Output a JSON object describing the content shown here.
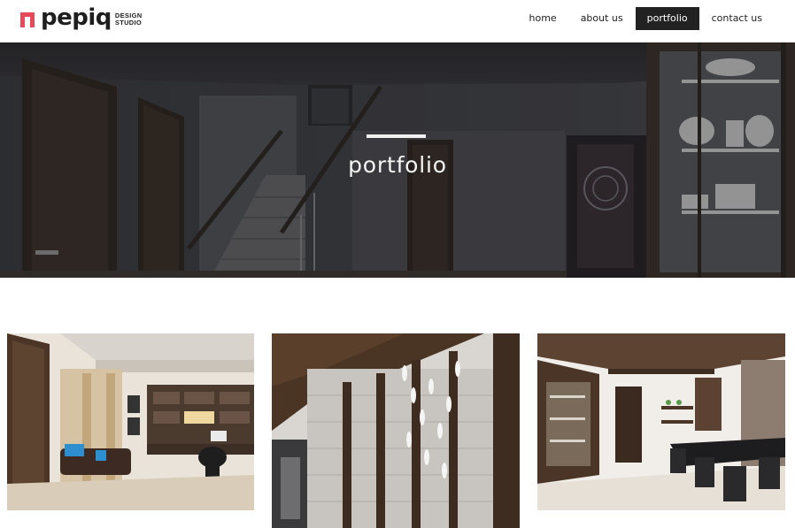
{
  "brand": {
    "name": "pepiq",
    "tagline_line1": "DESIGN",
    "tagline_line2": "STUDIO",
    "accent": "#e8495a"
  },
  "nav": {
    "items": [
      {
        "label": "home",
        "active": false
      },
      {
        "label": "about us",
        "active": false
      },
      {
        "label": "portfolio",
        "active": true
      },
      {
        "label": "contact us",
        "active": false
      }
    ]
  },
  "hero": {
    "title": "portfolio"
  },
  "gallery": {
    "items": [
      {
        "subject": "living room with study desk"
      },
      {
        "subject": "stone feature wall with pendant lights"
      },
      {
        "subject": "dining area with crockery unit"
      }
    ]
  }
}
